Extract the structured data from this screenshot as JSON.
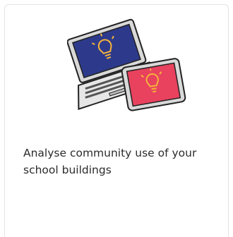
{
  "card": {
    "title": "Analyse community use of your school buildings",
    "illustration": {
      "icon": "laptop-and-tablet-lightbulb-icon",
      "colors": {
        "laptop_screen": "#2d3a8c",
        "tablet_screen": "#e8425e",
        "bulb": "#f5b33b",
        "outline": "#222222",
        "device_body": "#d9d9d9"
      }
    }
  }
}
